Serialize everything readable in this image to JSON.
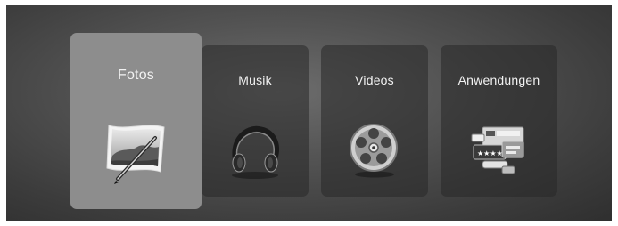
{
  "menu": {
    "tiles": [
      {
        "label": "Fotos",
        "icon": "photo-icon",
        "selected": true
      },
      {
        "label": "Musik",
        "icon": "headphones-icon",
        "selected": false
      },
      {
        "label": "Videos",
        "icon": "film-reel-icon",
        "selected": false
      },
      {
        "label": "Anwendungen",
        "icon": "apps-icon",
        "selected": false
      }
    ]
  }
}
